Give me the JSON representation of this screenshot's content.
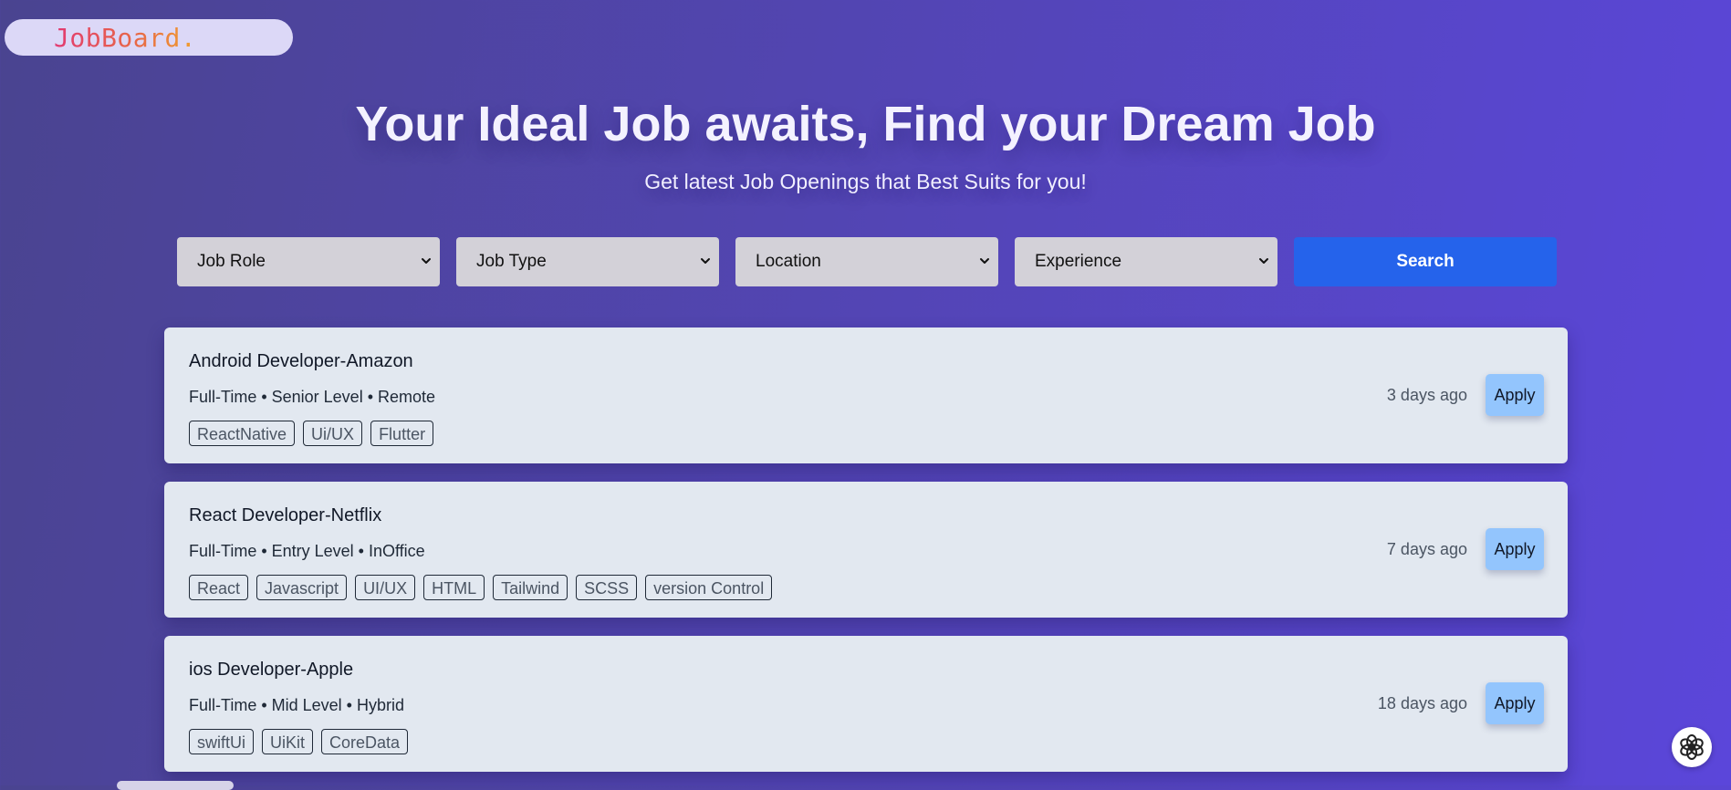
{
  "brand": {
    "logo_text": "JobBoard."
  },
  "hero": {
    "title": "Your Ideal Job awaits, Find your Dream Job",
    "subtitle": "Get latest Job Openings that Best Suits for you!"
  },
  "filters": {
    "job_role": "Job Role",
    "job_type": "Job Type",
    "location": "Location",
    "experience": "Experience",
    "search_label": "Search"
  },
  "jobs": [
    {
      "title": "Android Developer-Amazon",
      "meta": "Full-Time • Senior Level • Remote",
      "tags": [
        "ReactNative",
        "Ui/UX",
        "Flutter"
      ],
      "posted": "3 days ago",
      "apply_label": "Apply"
    },
    {
      "title": "React Developer-Netflix",
      "meta": "Full-Time • Entry Level • InOffice",
      "tags": [
        "React",
        "Javascript",
        "UI/UX",
        "HTML",
        "Tailwind",
        "SCSS",
        "version Control"
      ],
      "posted": "7 days ago",
      "apply_label": "Apply"
    },
    {
      "title": "ios Developer-Apple",
      "meta": "Full-Time • Mid Level • Hybrid",
      "tags": [
        "swiftUi",
        "UiKit",
        "CoreData"
      ],
      "posted": "18 days ago",
      "apply_label": "Apply"
    }
  ],
  "colors": {
    "background_start": "#4a4490",
    "background_end": "#5b46da",
    "search_button": "#2563eb",
    "apply_button": "#93c5fd",
    "card": "#e2e8f0"
  },
  "icons": {
    "select": "chevron-down-icon",
    "assistant": "assistant-logo-icon"
  }
}
